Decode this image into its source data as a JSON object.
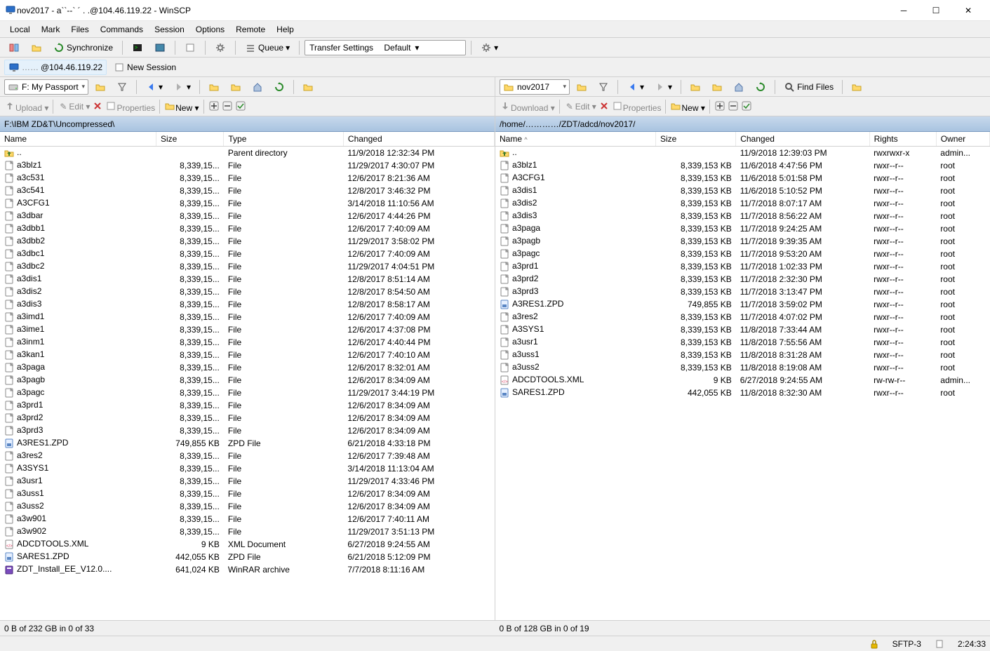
{
  "window": {
    "title": "nov2017 - a``--` ´ . .@104.46.119.22 - WinSCP"
  },
  "menu": [
    "Local",
    "Mark",
    "Files",
    "Commands",
    "Session",
    "Options",
    "Remote",
    "Help"
  ],
  "toolbar1": {
    "sync": "Synchronize",
    "queue": "Queue",
    "transfer_label": "Transfer Settings",
    "transfer_value": "Default"
  },
  "tabs": {
    "session": "@104.46.119.22",
    "new_session": "New Session"
  },
  "left": {
    "drive": "F: My Passport",
    "path": "F:\\IBM ZD&T\\Uncompressed\\",
    "toolbar": {
      "upload": "Upload",
      "edit": "Edit",
      "properties": "Properties",
      "new": "New"
    },
    "headers": {
      "name": "Name",
      "size": "Size",
      "type": "Type",
      "changed": "Changed"
    },
    "parent": {
      "name": "..",
      "type": "Parent directory",
      "changed": "11/9/2018  12:32:34 PM"
    },
    "files": [
      {
        "name": "a3blz1",
        "size": "8,339,15...",
        "type": "File",
        "changed": "11/29/2017  4:30:07 PM",
        "icon": "file"
      },
      {
        "name": "a3c531",
        "size": "8,339,15...",
        "type": "File",
        "changed": "12/6/2017  8:21:36 AM",
        "icon": "file"
      },
      {
        "name": "a3c541",
        "size": "8,339,15...",
        "type": "File",
        "changed": "12/8/2017  3:46:32 PM",
        "icon": "file"
      },
      {
        "name": "A3CFG1",
        "size": "8,339,15...",
        "type": "File",
        "changed": "3/14/2018  11:10:56 AM",
        "icon": "file"
      },
      {
        "name": "a3dbar",
        "size": "8,339,15...",
        "type": "File",
        "changed": "12/6/2017  4:44:26 PM",
        "icon": "file"
      },
      {
        "name": "a3dbb1",
        "size": "8,339,15...",
        "type": "File",
        "changed": "12/6/2017  7:40:09 AM",
        "icon": "file"
      },
      {
        "name": "a3dbb2",
        "size": "8,339,15...",
        "type": "File",
        "changed": "11/29/2017  3:58:02 PM",
        "icon": "file"
      },
      {
        "name": "a3dbc1",
        "size": "8,339,15...",
        "type": "File",
        "changed": "12/6/2017  7:40:09 AM",
        "icon": "file"
      },
      {
        "name": "a3dbc2",
        "size": "8,339,15...",
        "type": "File",
        "changed": "11/29/2017  4:04:51 PM",
        "icon": "file"
      },
      {
        "name": "a3dis1",
        "size": "8,339,15...",
        "type": "File",
        "changed": "12/8/2017  8:51:14 AM",
        "icon": "file"
      },
      {
        "name": "a3dis2",
        "size": "8,339,15...",
        "type": "File",
        "changed": "12/8/2017  8:54:50 AM",
        "icon": "file"
      },
      {
        "name": "a3dis3",
        "size": "8,339,15...",
        "type": "File",
        "changed": "12/8/2017  8:58:17 AM",
        "icon": "file"
      },
      {
        "name": "a3imd1",
        "size": "8,339,15...",
        "type": "File",
        "changed": "12/6/2017  7:40:09 AM",
        "icon": "file"
      },
      {
        "name": "a3ime1",
        "size": "8,339,15...",
        "type": "File",
        "changed": "12/6/2017  4:37:08 PM",
        "icon": "file"
      },
      {
        "name": "a3inm1",
        "size": "8,339,15...",
        "type": "File",
        "changed": "12/6/2017  4:40:44 PM",
        "icon": "file"
      },
      {
        "name": "a3kan1",
        "size": "8,339,15...",
        "type": "File",
        "changed": "12/6/2017  7:40:10 AM",
        "icon": "file"
      },
      {
        "name": "a3paga",
        "size": "8,339,15...",
        "type": "File",
        "changed": "12/6/2017  8:32:01 AM",
        "icon": "file"
      },
      {
        "name": "a3pagb",
        "size": "8,339,15...",
        "type": "File",
        "changed": "12/6/2017  8:34:09 AM",
        "icon": "file"
      },
      {
        "name": "a3pagc",
        "size": "8,339,15...",
        "type": "File",
        "changed": "11/29/2017  3:44:19 PM",
        "icon": "file"
      },
      {
        "name": "a3prd1",
        "size": "8,339,15...",
        "type": "File",
        "changed": "12/6/2017  8:34:09 AM",
        "icon": "file"
      },
      {
        "name": "a3prd2",
        "size": "8,339,15...",
        "type": "File",
        "changed": "12/6/2017  8:34:09 AM",
        "icon": "file"
      },
      {
        "name": "a3prd3",
        "size": "8,339,15...",
        "type": "File",
        "changed": "12/6/2017  8:34:09 AM",
        "icon": "file"
      },
      {
        "name": "A3RES1.ZPD",
        "size": "749,855 KB",
        "type": "ZPD File",
        "changed": "6/21/2018  4:33:18 PM",
        "icon": "zpd"
      },
      {
        "name": "a3res2",
        "size": "8,339,15...",
        "type": "File",
        "changed": "12/6/2017  7:39:48 AM",
        "icon": "file"
      },
      {
        "name": "A3SYS1",
        "size": "8,339,15...",
        "type": "File",
        "changed": "3/14/2018  11:13:04 AM",
        "icon": "file"
      },
      {
        "name": "a3usr1",
        "size": "8,339,15...",
        "type": "File",
        "changed": "11/29/2017  4:33:46 PM",
        "icon": "file"
      },
      {
        "name": "a3uss1",
        "size": "8,339,15...",
        "type": "File",
        "changed": "12/6/2017  8:34:09 AM",
        "icon": "file"
      },
      {
        "name": "a3uss2",
        "size": "8,339,15...",
        "type": "File",
        "changed": "12/6/2017  8:34:09 AM",
        "icon": "file"
      },
      {
        "name": "a3w901",
        "size": "8,339,15...",
        "type": "File",
        "changed": "12/6/2017  7:40:11 AM",
        "icon": "file"
      },
      {
        "name": "a3w902",
        "size": "8,339,15...",
        "type": "File",
        "changed": "11/29/2017  3:51:13 PM",
        "icon": "file"
      },
      {
        "name": "ADCDTOOLS.XML",
        "size": "9 KB",
        "type": "XML Document",
        "changed": "6/27/2018  9:24:55 AM",
        "icon": "xml"
      },
      {
        "name": "SARES1.ZPD",
        "size": "442,055 KB",
        "type": "ZPD File",
        "changed": "6/21/2018  5:12:09 PM",
        "icon": "zpd"
      },
      {
        "name": "ZDT_Install_EE_V12.0....",
        "size": "641,024 KB",
        "type": "WinRAR archive",
        "changed": "7/7/2018  8:11:16 AM",
        "icon": "rar"
      }
    ],
    "status": "0 B of 232 GB in 0 of 33"
  },
  "right": {
    "drive": "nov2017",
    "path": "/home/…………/ZDT/adcd/nov2017/",
    "toolbar": {
      "download": "Download",
      "edit": "Edit",
      "properties": "Properties",
      "new": "New",
      "find": "Find Files"
    },
    "headers": {
      "name": "Name",
      "size": "Size",
      "changed": "Changed",
      "rights": "Rights",
      "owner": "Owner"
    },
    "parent": {
      "name": "..",
      "changed": "11/9/2018 12:39:03 PM",
      "rights": "rwxrwxr-x",
      "owner": "admin..."
    },
    "files": [
      {
        "name": "a3blz1",
        "size": "8,339,153 KB",
        "changed": "11/6/2018 4:47:56 PM",
        "rights": "rwxr--r--",
        "owner": "root",
        "icon": "file"
      },
      {
        "name": "A3CFG1",
        "size": "8,339,153 KB",
        "changed": "11/6/2018 5:01:58 PM",
        "rights": "rwxr--r--",
        "owner": "root",
        "icon": "file"
      },
      {
        "name": "a3dis1",
        "size": "8,339,153 KB",
        "changed": "11/6/2018 5:10:52 PM",
        "rights": "rwxr--r--",
        "owner": "root",
        "icon": "file"
      },
      {
        "name": "a3dis2",
        "size": "8,339,153 KB",
        "changed": "11/7/2018 8:07:17 AM",
        "rights": "rwxr--r--",
        "owner": "root",
        "icon": "file"
      },
      {
        "name": "a3dis3",
        "size": "8,339,153 KB",
        "changed": "11/7/2018 8:56:22 AM",
        "rights": "rwxr--r--",
        "owner": "root",
        "icon": "file"
      },
      {
        "name": "a3paga",
        "size": "8,339,153 KB",
        "changed": "11/7/2018 9:24:25 AM",
        "rights": "rwxr--r--",
        "owner": "root",
        "icon": "file"
      },
      {
        "name": "a3pagb",
        "size": "8,339,153 KB",
        "changed": "11/7/2018 9:39:35 AM",
        "rights": "rwxr--r--",
        "owner": "root",
        "icon": "file"
      },
      {
        "name": "a3pagc",
        "size": "8,339,153 KB",
        "changed": "11/7/2018 9:53:20 AM",
        "rights": "rwxr--r--",
        "owner": "root",
        "icon": "file"
      },
      {
        "name": "a3prd1",
        "size": "8,339,153 KB",
        "changed": "11/7/2018 1:02:33 PM",
        "rights": "rwxr--r--",
        "owner": "root",
        "icon": "file"
      },
      {
        "name": "a3prd2",
        "size": "8,339,153 KB",
        "changed": "11/7/2018 2:32:30 PM",
        "rights": "rwxr--r--",
        "owner": "root",
        "icon": "file"
      },
      {
        "name": "a3prd3",
        "size": "8,339,153 KB",
        "changed": "11/7/2018 3:13:47 PM",
        "rights": "rwxr--r--",
        "owner": "root",
        "icon": "file"
      },
      {
        "name": "A3RES1.ZPD",
        "size": "749,855 KB",
        "changed": "11/7/2018 3:59:02 PM",
        "rights": "rwxr--r--",
        "owner": "root",
        "icon": "zpd"
      },
      {
        "name": "a3res2",
        "size": "8,339,153 KB",
        "changed": "11/7/2018 4:07:02 PM",
        "rights": "rwxr--r--",
        "owner": "root",
        "icon": "file"
      },
      {
        "name": "A3SYS1",
        "size": "8,339,153 KB",
        "changed": "11/8/2018 7:33:44 AM",
        "rights": "rwxr--r--",
        "owner": "root",
        "icon": "file"
      },
      {
        "name": "a3usr1",
        "size": "8,339,153 KB",
        "changed": "11/8/2018 7:55:56 AM",
        "rights": "rwxr--r--",
        "owner": "root",
        "icon": "file"
      },
      {
        "name": "a3uss1",
        "size": "8,339,153 KB",
        "changed": "11/8/2018 8:31:28 AM",
        "rights": "rwxr--r--",
        "owner": "root",
        "icon": "file"
      },
      {
        "name": "a3uss2",
        "size": "8,339,153 KB",
        "changed": "11/8/2018 8:19:08 AM",
        "rights": "rwxr--r--",
        "owner": "root",
        "icon": "file"
      },
      {
        "name": "ADCDTOOLS.XML",
        "size": "9 KB",
        "changed": "6/27/2018 9:24:55 AM",
        "rights": "rw-rw-r--",
        "owner": "admin...",
        "icon": "xml"
      },
      {
        "name": "SARES1.ZPD",
        "size": "442,055 KB",
        "changed": "11/8/2018 8:32:30 AM",
        "rights": "rwxr--r--",
        "owner": "root",
        "icon": "zpd"
      }
    ],
    "status": "0 B of 128 GB in 0 of 19"
  },
  "bottom": {
    "protocol": "SFTP-3",
    "time": "2:24:33"
  }
}
